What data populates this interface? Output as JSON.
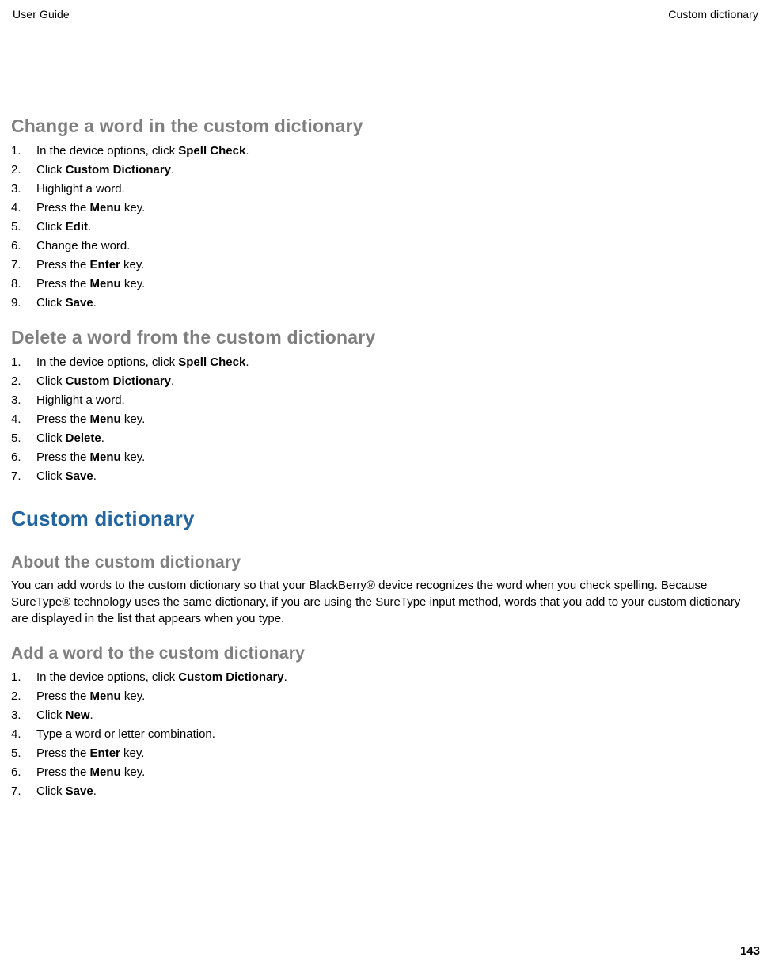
{
  "header": {
    "left": "User Guide",
    "right": "Custom dictionary"
  },
  "page_number": "143",
  "sections": [
    {
      "heading": "Change a word in the custom dictionary",
      "heading_class": "section-heading",
      "type": "steps",
      "steps": [
        [
          [
            "In the device options, click "
          ],
          [
            "b",
            "Spell Check"
          ],
          [
            "."
          ]
        ],
        [
          [
            "Click "
          ],
          [
            "b",
            "Custom Dictionary"
          ],
          [
            "."
          ]
        ],
        [
          [
            "Highlight a word."
          ]
        ],
        [
          [
            "Press the "
          ],
          [
            "b",
            "Menu"
          ],
          [
            " key."
          ]
        ],
        [
          [
            "Click "
          ],
          [
            "b",
            "Edit"
          ],
          [
            "."
          ]
        ],
        [
          [
            "Change the word."
          ]
        ],
        [
          [
            "Press the "
          ],
          [
            "b",
            "Enter"
          ],
          [
            " key."
          ]
        ],
        [
          [
            "Press the "
          ],
          [
            "b",
            "Menu"
          ],
          [
            " key."
          ]
        ],
        [
          [
            "Click "
          ],
          [
            "b",
            "Save"
          ],
          [
            "."
          ]
        ]
      ]
    },
    {
      "heading": "Delete a word from the custom dictionary",
      "heading_class": "section-heading",
      "type": "steps",
      "steps": [
        [
          [
            "In the device options, click "
          ],
          [
            "b",
            "Spell Check"
          ],
          [
            "."
          ]
        ],
        [
          [
            "Click "
          ],
          [
            "b",
            "Custom Dictionary"
          ],
          [
            "."
          ]
        ],
        [
          [
            "Highlight a word."
          ]
        ],
        [
          [
            "Press the "
          ],
          [
            "b",
            "Menu"
          ],
          [
            " key."
          ]
        ],
        [
          [
            "Click "
          ],
          [
            "b",
            "Delete"
          ],
          [
            "."
          ]
        ],
        [
          [
            "Press the "
          ],
          [
            "b",
            "Menu"
          ],
          [
            " key."
          ]
        ],
        [
          [
            "Click "
          ],
          [
            "b",
            "Save"
          ],
          [
            "."
          ]
        ]
      ]
    },
    {
      "heading": "Custom dictionary",
      "heading_class": "section-heading major",
      "type": "none"
    },
    {
      "heading": "About the custom dictionary",
      "heading_class": "section-heading sub",
      "type": "paragraph",
      "paragraph": "You can add words to the custom dictionary so that your BlackBerry® device recognizes the word when you check spelling. Because SureType® technology uses the same dictionary, if you are using the SureType input method, words that you add to your custom dictionary are displayed in the list that appears when you type."
    },
    {
      "heading": "Add a word to the custom dictionary",
      "heading_class": "section-heading sub",
      "type": "steps",
      "steps": [
        [
          [
            "In the device options, click "
          ],
          [
            "b",
            "Custom Dictionary"
          ],
          [
            "."
          ]
        ],
        [
          [
            "Press the "
          ],
          [
            "b",
            "Menu"
          ],
          [
            " key."
          ]
        ],
        [
          [
            "Click "
          ],
          [
            "b",
            "New"
          ],
          [
            "."
          ]
        ],
        [
          [
            "Type a word or letter combination."
          ]
        ],
        [
          [
            "Press the "
          ],
          [
            "b",
            "Enter"
          ],
          [
            " key."
          ]
        ],
        [
          [
            "Press the "
          ],
          [
            "b",
            "Menu"
          ],
          [
            " key."
          ]
        ],
        [
          [
            "Click "
          ],
          [
            "b",
            "Save"
          ],
          [
            "."
          ]
        ]
      ]
    }
  ]
}
